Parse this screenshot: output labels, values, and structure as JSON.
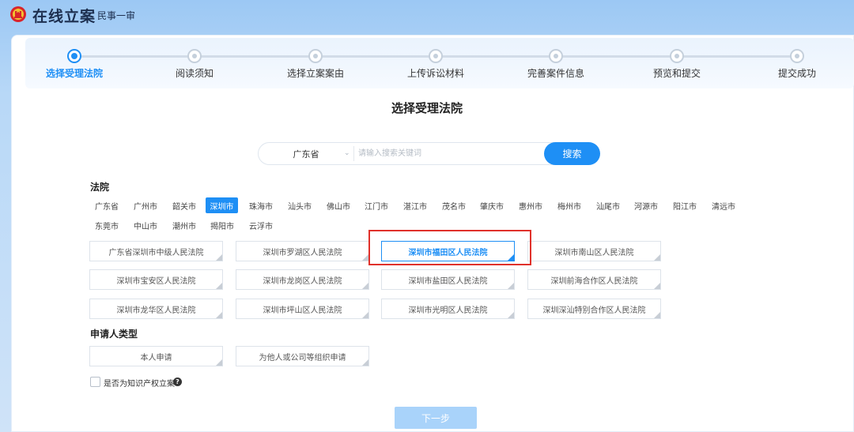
{
  "header": {
    "title": "在线立案",
    "subtitle": "民事一审"
  },
  "steps": [
    {
      "label": "选择受理法院",
      "active": true
    },
    {
      "label": "阅读须知",
      "active": false
    },
    {
      "label": "选择立案案由",
      "active": false
    },
    {
      "label": "上传诉讼材料",
      "active": false
    },
    {
      "label": "完善案件信息",
      "active": false
    },
    {
      "label": "预览和提交",
      "active": false
    },
    {
      "label": "提交成功",
      "active": false
    }
  ],
  "page_title": "选择受理法院",
  "search": {
    "province": "广东省",
    "placeholder": "请输入搜索关键词",
    "button_label": "搜索"
  },
  "courts_section": {
    "label": "法院",
    "cities": [
      "广东省",
      "广州市",
      "韶关市",
      "深圳市",
      "珠海市",
      "汕头市",
      "佛山市",
      "江门市",
      "湛江市",
      "茂名市",
      "肇庆市",
      "惠州市",
      "梅州市",
      "汕尾市",
      "河源市",
      "阳江市",
      "清远市",
      "东莞市",
      "中山市",
      "潮州市",
      "揭阳市",
      "云浮市"
    ],
    "selected_city": "深圳市",
    "courts": [
      "广东省深圳市中级人民法院",
      "深圳市罗湖区人民法院",
      "深圳市福田区人民法院",
      "深圳市南山区人民法院",
      "深圳市宝安区人民法院",
      "深圳市龙岗区人民法院",
      "深圳市盐田区人民法院",
      "深圳前海合作区人民法院",
      "深圳市龙华区人民法院",
      "深圳市坪山区人民法院",
      "深圳市光明区人民法院",
      "深圳深汕特别合作区人民法院"
    ],
    "selected_court": "深圳市福田区人民法院"
  },
  "applicant_section": {
    "label": "申请人类型",
    "options": [
      "本人申请",
      "为他人或公司等组织申请"
    ]
  },
  "ip_case": {
    "label": "是否为知识产权立案",
    "help": "?"
  },
  "next_button": "下一步",
  "colors": {
    "accent": "#1e8ff5",
    "highlight": "#e0312b",
    "disabled_button": "#a9d3fa"
  }
}
